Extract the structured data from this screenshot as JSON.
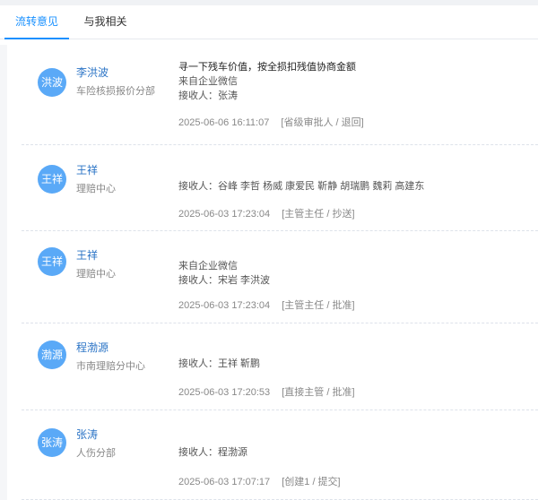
{
  "tabs": [
    {
      "label": "流转意见",
      "active": true
    },
    {
      "label": "与我相关",
      "active": false
    }
  ],
  "records": [
    {
      "avatar": "洪波",
      "name": "李洪波",
      "dept": "车险核损报价分部",
      "opinion": "寻一下残车价值，按全损扣残值协商金额",
      "source": "来自企业微信",
      "receivers": "接收人：张涛",
      "time": "2025-06-06 16:11:07",
      "role": "[省级审批人 / 退回]"
    },
    {
      "avatar": "王祥",
      "name": "王祥",
      "dept": "理赔中心",
      "opinion": "",
      "source": "",
      "receivers": "接收人：谷峰 李哲 杨威 康爱民 靳静 胡瑞鹏 魏莉 高建东",
      "time": "2025-06-03 17:23:04",
      "role": "[主管主任 / 抄送]"
    },
    {
      "avatar": "王祥",
      "name": "王祥",
      "dept": "理赔中心",
      "opinion": "",
      "source": "来自企业微信",
      "receivers": "接收人：宋岩 李洪波",
      "time": "2025-06-03 17:23:04",
      "role": "[主管主任 / 批准]"
    },
    {
      "avatar": "渤源",
      "name": "程渤源",
      "dept": "市南理赔分中心",
      "opinion": "",
      "source": "",
      "receivers": "接收人：王祥 靳鹏",
      "time": "2025-06-03 17:20:53",
      "role": "[直接主管 / 批准]"
    },
    {
      "avatar": "张涛",
      "name": "张涛",
      "dept": "人伤分部",
      "opinion": "",
      "source": "",
      "receivers": "接收人：程渤源",
      "time": "2025-06-03 17:07:17",
      "role": "[创建1 / 提交]"
    }
  ],
  "colors": {
    "accent": "#1890ff",
    "avatar": "#5aa9f7",
    "name": "#2b74c6",
    "muted": "#888888"
  }
}
